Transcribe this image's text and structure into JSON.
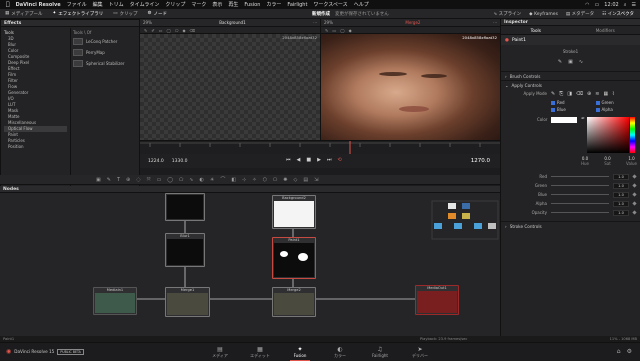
{
  "menubar": {
    "app_name": "DaVinci Resolve",
    "items": [
      "ファイル",
      "編集",
      "トリム",
      "タイムライン",
      "クリップ",
      "マーク",
      "表示",
      "再生",
      "Fusion",
      "カラー",
      "Fairlight",
      "ワークスペース",
      "ヘルプ"
    ],
    "clock": "12:02"
  },
  "toolbar": {
    "media_pool": "メディアプール",
    "effects_library": "エフェクトライブラリ",
    "clips": "クリップ",
    "nodes": "ノード",
    "project_title": "新規作成",
    "project_status": "変更が保存されていません",
    "spline": "スプライン",
    "keyframes": "Keyframes",
    "metadata": "メタデータ",
    "inspector": "インスペクタ"
  },
  "effects": {
    "title": "Effects",
    "tree": [
      {
        "label": "Tools",
        "top": true
      },
      {
        "label": "3D"
      },
      {
        "label": "Blur"
      },
      {
        "label": "Color"
      },
      {
        "label": "Composite"
      },
      {
        "label": "Deep Pixel"
      },
      {
        "label": "Effect"
      },
      {
        "label": "Film"
      },
      {
        "label": "Filter"
      },
      {
        "label": "Flow"
      },
      {
        "label": "Generator"
      },
      {
        "label": "I/O"
      },
      {
        "label": "LUT"
      },
      {
        "label": "Mask"
      },
      {
        "label": "Matte"
      },
      {
        "label": "Miscellaneous"
      },
      {
        "label": "Optical Flow",
        "sel": true
      },
      {
        "label": "Paint"
      },
      {
        "label": "Particles"
      },
      {
        "label": "Position"
      }
    ],
    "path": "Tools \\ Of",
    "list": [
      "LeConq Patcher",
      "PerryMap",
      "Spherical Stabilizer"
    ]
  },
  "viewer_left": {
    "zoom": "29%",
    "title": "Background1",
    "resolution": "2048x858xfloat32"
  },
  "viewer_right": {
    "zoom": "29%",
    "title": "Merge2",
    "resolution": "2048x858xfloat32"
  },
  "transport": {
    "in_frame": "1224.0",
    "out_frame": "1330.0",
    "current_frame": "1270.0"
  },
  "nodes_panel": {
    "title": "Nodes"
  },
  "nodes": [
    {
      "id": "background2",
      "label": "Background2"
    },
    {
      "id": "blur1",
      "label": "Blur1"
    },
    {
      "id": "paint1",
      "label": "Paint1"
    },
    {
      "id": "mediain1",
      "label": "MediaIn1"
    },
    {
      "id": "merge1",
      "label": "Merge1"
    },
    {
      "id": "merge2",
      "label": "Merge2"
    },
    {
      "id": "mediaout1",
      "label": "MediaOut1"
    }
  ],
  "inspector": {
    "title": "Inspector",
    "tab_tools": "Tools",
    "tab_modifiers": "Modifiers",
    "node_name": "Paint1",
    "stroke_name": "Stroke1",
    "brush_controls": "Brush Controls",
    "apply_controls": "Apply Controls",
    "apply_mode": "Apply Mode",
    "channels": [
      "Red",
      "Green",
      "Blue",
      "Alpha"
    ],
    "color_label": "Color",
    "hsv": [
      {
        "v": "0.0",
        "l": "Hue"
      },
      {
        "v": "0.0",
        "l": "Sat"
      },
      {
        "v": "1.0",
        "l": "Value"
      }
    ],
    "params": [
      {
        "label": "Red",
        "value": "1.0"
      },
      {
        "label": "Green",
        "value": "1.0"
      },
      {
        "label": "Blue",
        "value": "1.0"
      },
      {
        "label": "Alpha",
        "value": "1.0"
      },
      {
        "label": "Opacity",
        "value": "1.0"
      }
    ],
    "stroke_controls": "Stroke Controls"
  },
  "statusbar": {
    "left": "Paint1",
    "mid": "Playback: 23.9 frames/sec",
    "right": "11% - 1068 MB",
    "app_version": "DaVinci Resolve 15",
    "badge": "PUBLIC BETA"
  },
  "pages": [
    {
      "label": "メディア",
      "icon": "media-page-icon",
      "glyph": "▤"
    },
    {
      "label": "エディット",
      "icon": "edit-page-icon",
      "glyph": "▦"
    },
    {
      "label": "Fusion",
      "icon": "fusion-page-icon",
      "glyph": "✦",
      "active": true
    },
    {
      "label": "カラー",
      "icon": "color-page-icon",
      "glyph": "◐"
    },
    {
      "label": "Fairlight",
      "icon": "fairlight-page-icon",
      "glyph": "♫"
    },
    {
      "label": "デリバー",
      "icon": "deliver-page-icon",
      "glyph": "➤"
    }
  ],
  "colors": {
    "accent": "#e2554c",
    "brush_color": "#ffffff"
  }
}
